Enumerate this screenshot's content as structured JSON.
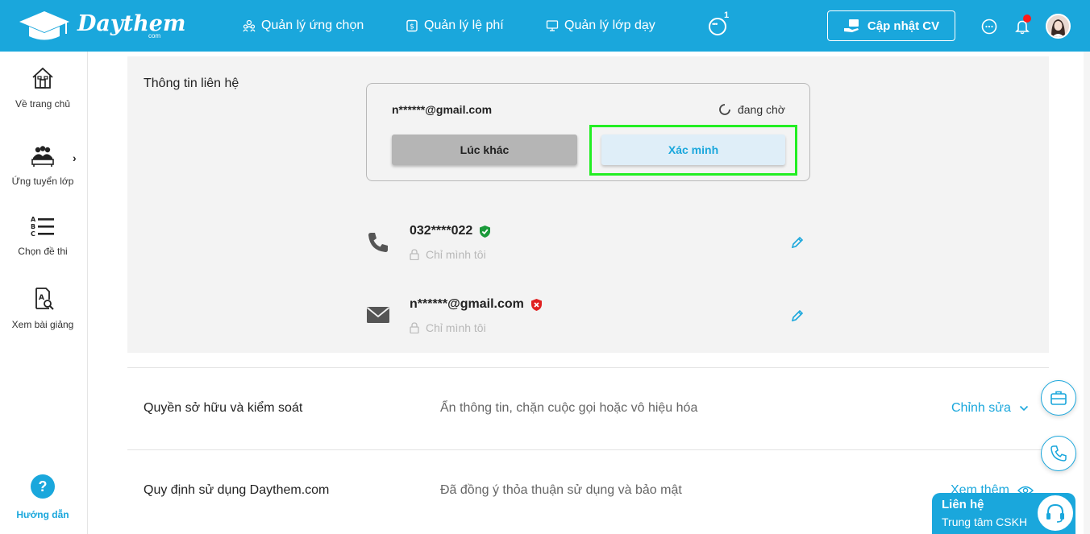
{
  "brand": {
    "name": "Daythem",
    "sub": "com"
  },
  "nav": {
    "items": [
      {
        "label": "Quản lý ứng chọn",
        "icon": "users-icon"
      },
      {
        "label": "Quản lý lệ phí",
        "icon": "fee-icon"
      },
      {
        "label": "Quản lý lớp dạy",
        "icon": "monitor-icon"
      }
    ],
    "more_badge": "1",
    "cv_button": "Cập nhật CV"
  },
  "sidebar": {
    "items": [
      {
        "label": "Về trang chủ",
        "icon": "home-icon"
      },
      {
        "label": "Ứng tuyển lớp",
        "icon": "class-group-icon"
      },
      {
        "label": "Chọn đề thi",
        "icon": "abc-list-icon"
      },
      {
        "label": "Xem bài giảng",
        "icon": "lesson-search-icon"
      }
    ],
    "arrow": "›",
    "help_symbol": "?",
    "help_label": "Hướng dẫn"
  },
  "contact": {
    "label": "Thông tin liên hệ",
    "verify_box": {
      "email": "n******@gmail.com",
      "status": "đang chờ",
      "later_button": "Lúc khác",
      "verify_button": "Xác minh"
    },
    "rows": [
      {
        "value": "032****022",
        "privacy": "Chỉ mình tôi",
        "verified": true
      },
      {
        "value": "n******@gmail.com",
        "privacy": "Chỉ mình tôi",
        "verified": false
      }
    ]
  },
  "sections": [
    {
      "title": "Quyền sở hữu và kiểm soát",
      "desc": "Ẩn thông tin, chặn cuộc gọi hoặc vô hiệu hóa",
      "action": "Chỉnh sửa"
    },
    {
      "title": "Quy định sử dụng Daythem.com",
      "desc": "Đã đồng ý thỏa thuận sử dụng và bảo mật",
      "action": "Xem thêm"
    }
  ],
  "contact_widget": {
    "title": "Liên hệ",
    "sub": "Trung tâm CSKH"
  },
  "colors": {
    "primary": "#1aa7dc",
    "highlight": "#22ee22",
    "verified": "#1a9a3a",
    "unverified": "#e02020"
  }
}
